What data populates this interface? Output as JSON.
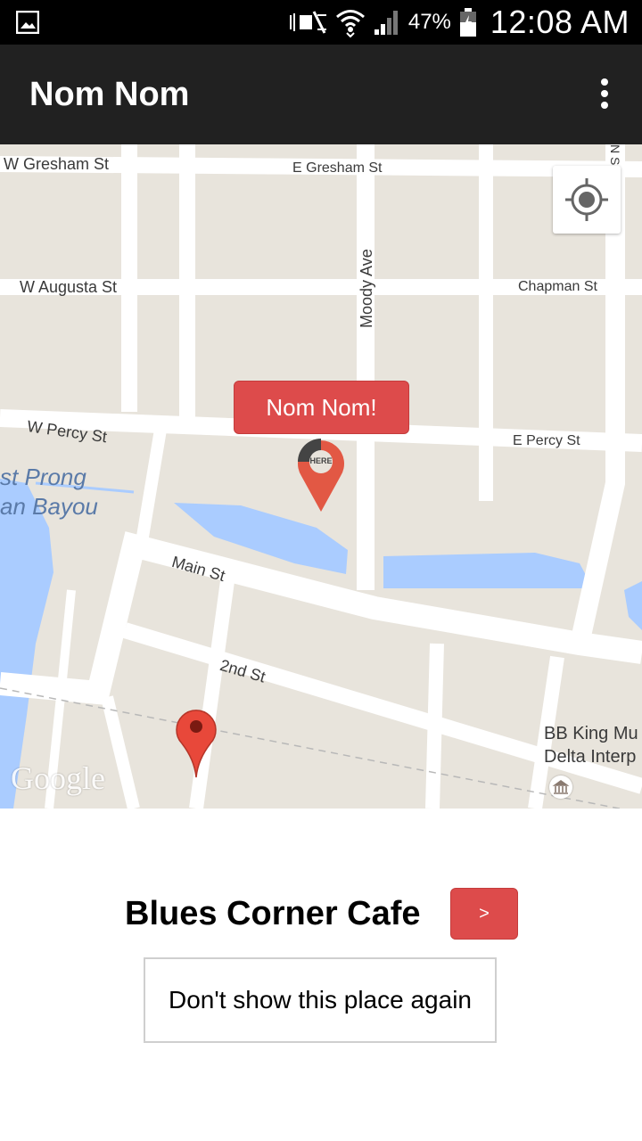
{
  "status_bar": {
    "battery_percent": "47%",
    "time": "12:08 AM",
    "icons": [
      "image-icon",
      "mute-icon",
      "wifi-icon",
      "signal-icon",
      "battery-icon"
    ]
  },
  "app_bar": {
    "title": "Nom Nom",
    "overflow_icon": "more-vert-icon"
  },
  "map": {
    "streets": {
      "w_gresham": "W Gresham St",
      "e_gresham": "E Gresham St",
      "n_sunflower": "N Sunflo",
      "w_augusta": "W Augusta St",
      "moody": "Moody Ave",
      "chapman": "Chapman St",
      "w_percy": "W Percy St",
      "e_percy": "E Percy St",
      "main": "Main St",
      "second": "2nd St",
      "bb_king_1": "BB King Mu",
      "bb_king_2": "Delta Interp"
    },
    "bayou_1": "st Prong",
    "bayou_2": "an Bayou",
    "bubble_label": "Nom Nom!",
    "here_marker_label": "HERE",
    "google_logo": "Google",
    "colors": {
      "accent": "#dd4b4b",
      "water": "#aaccff",
      "road": "#ffffff",
      "land": "#e8e4dc"
    }
  },
  "place": {
    "name": "Blues Corner Cafe",
    "next_label": ">",
    "hide_label": "Don't show this place again"
  }
}
